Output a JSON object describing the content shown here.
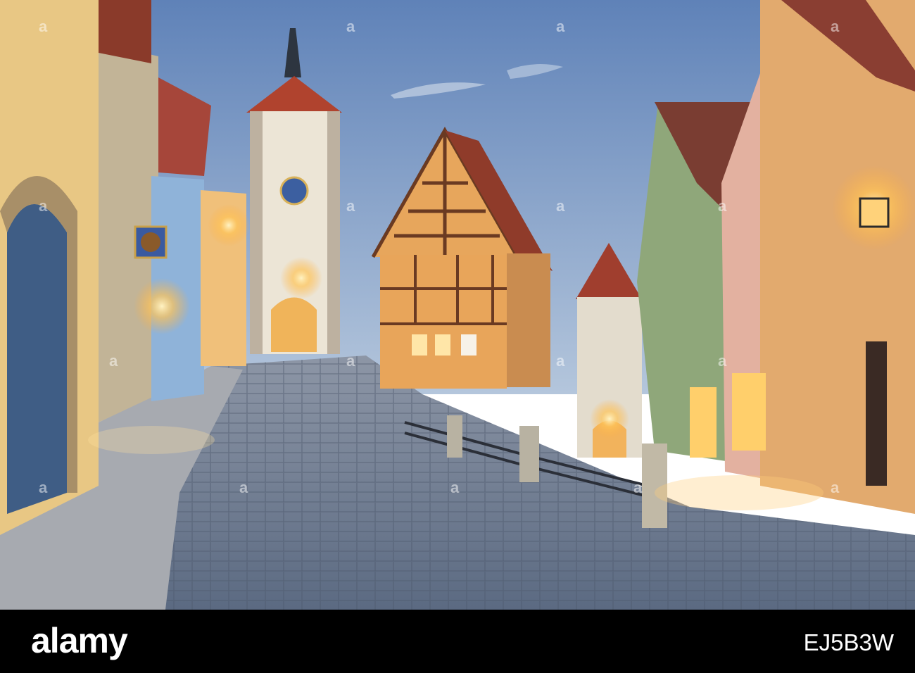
{
  "photo": {
    "subject": "",
    "palette": {
      "sky_top": "#6f8fbf",
      "sky_bottom": "#a9bed8",
      "cobble": "#6f7f96",
      "lamp": "#ffd27a",
      "roof": "#9a3a2a",
      "timber": "#6a3a22",
      "plaster_orange": "#e7a65c"
    }
  },
  "watermark": {
    "brand": "alamy",
    "image_id": "EJ5B3W",
    "overlay_glyph": "a"
  }
}
